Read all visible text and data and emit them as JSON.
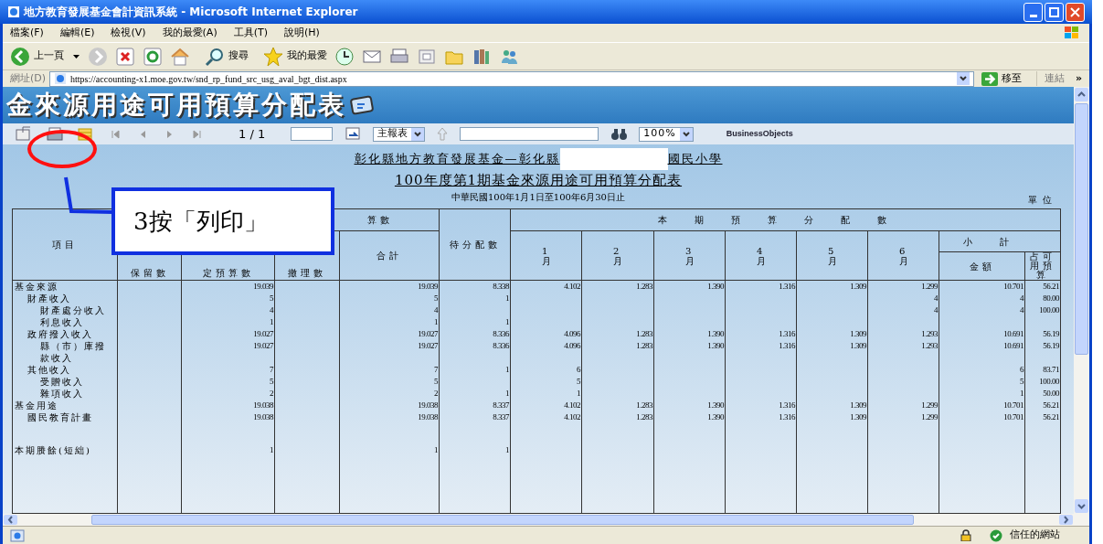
{
  "window": {
    "title": "地方教育發展基金會計資訊系統 - Microsoft Internet Explorer"
  },
  "menu": [
    {
      "label": "檔案(F)"
    },
    {
      "label": "編輯(E)"
    },
    {
      "label": "檢視(V)"
    },
    {
      "label": "我的最愛(A)"
    },
    {
      "label": "工具(T)"
    },
    {
      "label": "說明(H)"
    }
  ],
  "toolbar": {
    "back": "上一頁",
    "search": "搜尋",
    "favorites": "我的最愛"
  },
  "address_bar": {
    "label": "網址(D)",
    "url": "https://accounting-x1.moe.gov.tw/snd_rp_fund_src_usg_aval_bgt_dist.aspx",
    "go": "移至",
    "links": "連結",
    "more": "»"
  },
  "banner": {
    "title": "金來源用途可用預算分配表"
  },
  "report_toolbar": {
    "page": "1 / 1",
    "view": "主報表",
    "zoom": "100%",
    "brand": "BusinessObjects"
  },
  "report": {
    "org_before": "彰化縣地方教育發展基金—彰化縣",
    "org_after": "國民小學",
    "title": "100年度第1期基金來源用途可用預算分配表",
    "period": "中華民國100年1月1日至100年6月30日止",
    "unit": "單位",
    "columns": {
      "item": "項目",
      "group_budget": "算數",
      "reserved": "保留數",
      "budget": "定預算數",
      "col_4": "撤理數",
      "total": "合計",
      "pending": "待分配數",
      "group_period": "本期預算分配數",
      "m1": "1月",
      "m2": "2月",
      "m3": "3月",
      "m4": "4月",
      "m5": "5月",
      "m6": "6月",
      "subtotal": "小計",
      "amount": "金額",
      "percent": "占可用預算"
    },
    "rows": [
      {
        "label": "基金來源",
        "cells": {
          "budget": "19.039",
          "total": "19.039",
          "pending": "8.338",
          "m1": "4.102",
          "m2": "1.283",
          "m3": "1.390",
          "m4": "1.316",
          "m5": "1.309",
          "m6": "1.299",
          "amount": "10.701",
          "percent": "56.21"
        },
        "children": [
          {
            "label": "財產收入",
            "cells": {
              "budget": "5",
              "total": "5",
              "pending": "1",
              "m6": "4",
              "amount": "4",
              "percent": "80.00"
            },
            "children": [
              {
                "label": "財產處分收入",
                "cells": {
                  "budget": "4",
                  "total": "4",
                  "m6": "4",
                  "amount": "4",
                  "percent": "100.00"
                }
              },
              {
                "label": "利息收入",
                "cells": {
                  "budget": "1",
                  "total": "1",
                  "pending": "1"
                }
              }
            ]
          },
          {
            "label": "政府撥入收入",
            "cells": {
              "budget": "19.027",
              "total": "19.027",
              "pending": "8.336",
              "m1": "4.096",
              "m2": "1.283",
              "m3": "1.390",
              "m4": "1.316",
              "m5": "1.309",
              "m6": "1.293",
              "amount": "10.691",
              "percent": "56.19"
            },
            "children": [
              {
                "label": "縣（市）庫撥款收入",
                "cells": {
                  "budget": "19.027",
                  "total": "19.027",
                  "pending": "8.336",
                  "m1": "4.096",
                  "m2": "1.283",
                  "m3": "1.390",
                  "m4": "1.316",
                  "m5": "1.309",
                  "m6": "1.293",
                  "amount": "10.691",
                  "percent": "56.19"
                }
              }
            ]
          },
          {
            "label": "其他收入",
            "cells": {
              "budget": "7",
              "total": "7",
              "pending": "1",
              "m1": "6",
              "amount": "6",
              "percent": "83.71"
            },
            "children": [
              {
                "label": "受贈收入",
                "cells": {
                  "budget": "5",
                  "total": "5",
                  "m1": "5",
                  "amount": "5",
                  "percent": "100.00"
                }
              },
              {
                "label": "雜項收入",
                "cells": {
                  "budget": "2",
                  "total": "2",
                  "pending": "1",
                  "m1": "1",
                  "amount": "1",
                  "percent": "50.00"
                }
              }
            ]
          }
        ]
      },
      {
        "label": "基金用途",
        "cells": {
          "budget": "19.038",
          "total": "19.038",
          "pending": "8.337",
          "m1": "4.102",
          "m2": "1.283",
          "m3": "1.390",
          "m4": "1.316",
          "m5": "1.309",
          "m6": "1.299",
          "amount": "10.701",
          "percent": "56.21"
        },
        "children": [
          {
            "label": "國民教育計畫",
            "cells": {
              "budget": "19.038",
              "total": "19.038",
              "pending": "8.337",
              "m1": "4.102",
              "m2": "1.283",
              "m3": "1.390",
              "m4": "1.316",
              "m5": "1.309",
              "m6": "1.299",
              "amount": "10.701",
              "percent": "56.21"
            }
          }
        ]
      },
      {
        "kind": "spacer"
      },
      {
        "label": "本期賸餘(短絀)",
        "cells": {
          "budget": "1",
          "total": "1",
          "pending": "1"
        }
      }
    ]
  },
  "annotation": {
    "text": "3按「列印」"
  },
  "status_bar": {
    "zone": "信任的網站"
  }
}
